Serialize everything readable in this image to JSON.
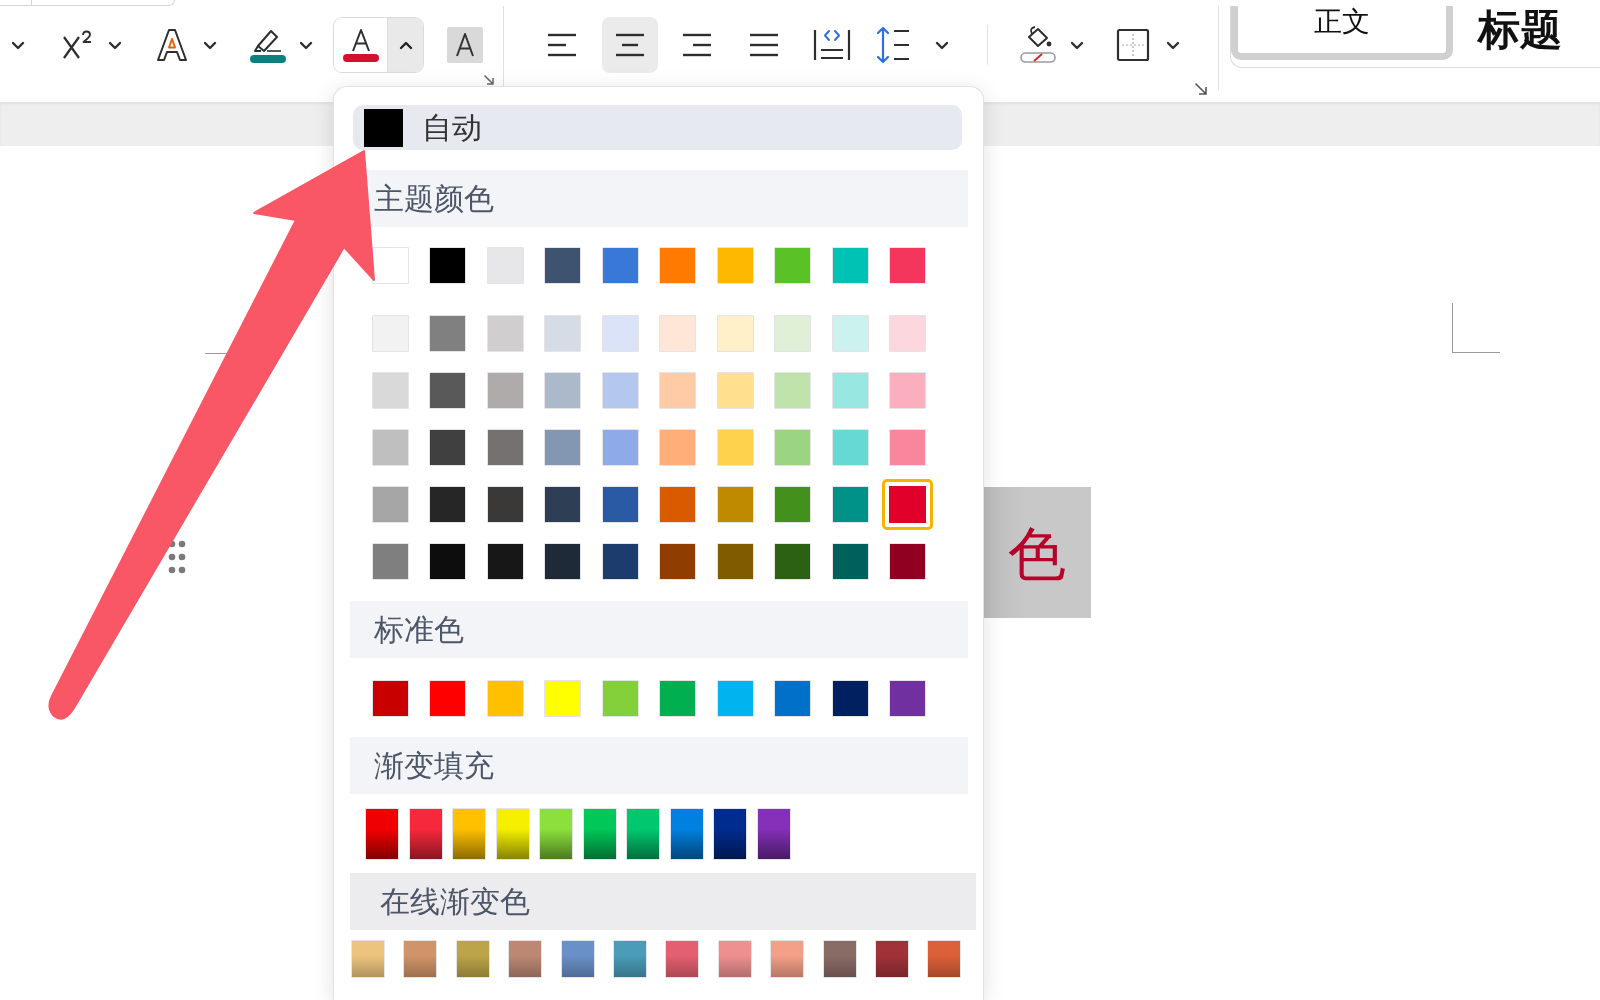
{
  "toolbar": {
    "font_color_button": {
      "expanded": true
    },
    "alignment": [
      {
        "kind": "left",
        "selected": false
      },
      {
        "kind": "center",
        "selected": true
      },
      {
        "kind": "right",
        "selected": false
      },
      {
        "kind": "justify",
        "selected": false
      },
      {
        "kind": "distributed",
        "selected": false
      }
    ],
    "styles": [
      {
        "kind": "body",
        "label": "正文",
        "selected": true
      },
      {
        "kind": "heading",
        "label": "标题",
        "selected": false
      }
    ]
  },
  "document": {
    "highlighted_text": "色"
  },
  "color_menu": {
    "auto": {
      "label": "自动",
      "color": "#000000"
    },
    "sections": [
      {
        "kind": "grid",
        "title": "主题颜色",
        "rows": [
          [
            {
              "color": "#ffffff",
              "selected": false
            },
            {
              "color": "#000000",
              "selected": false
            },
            {
              "color": "#e7e6e8",
              "selected": false
            },
            {
              "color": "#3e5370",
              "selected": false
            },
            {
              "color": "#3a78d8",
              "selected": false
            },
            {
              "color": "#ff7a00",
              "selected": false
            },
            {
              "color": "#ffb800",
              "selected": false
            },
            {
              "color": "#5ac126",
              "selected": false
            },
            {
              "color": "#00c2b4",
              "selected": false
            },
            {
              "color": "#f5365c",
              "selected": false
            }
          ],
          [
            {
              "color": "#f2f2f2",
              "selected": false
            },
            {
              "color": "#808080",
              "selected": false
            },
            {
              "color": "#d0cece",
              "selected": false
            },
            {
              "color": "#d6dce5",
              "selected": false
            },
            {
              "color": "#dae3f8",
              "selected": false
            },
            {
              "color": "#ffe6d6",
              "selected": false
            },
            {
              "color": "#fff0c9",
              "selected": false
            },
            {
              "color": "#dff0d7",
              "selected": false
            },
            {
              "color": "#ccf2ef",
              "selected": false
            },
            {
              "color": "#fdd7de",
              "selected": false
            }
          ],
          [
            {
              "color": "#d9d9d9",
              "selected": false
            },
            {
              "color": "#595959",
              "selected": false
            },
            {
              "color": "#afabab",
              "selected": false
            },
            {
              "color": "#acb9ca",
              "selected": false
            },
            {
              "color": "#b4c7ef",
              "selected": false
            },
            {
              "color": "#ffcaa6",
              "selected": false
            },
            {
              "color": "#ffe08f",
              "selected": false
            },
            {
              "color": "#bfe3aa",
              "selected": false
            },
            {
              "color": "#99e7e1",
              "selected": false
            },
            {
              "color": "#fbaebd",
              "selected": false
            }
          ],
          [
            {
              "color": "#bfbfbf",
              "selected": false
            },
            {
              "color": "#404040",
              "selected": false
            },
            {
              "color": "#767171",
              "selected": false
            },
            {
              "color": "#8497b0",
              "selected": false
            },
            {
              "color": "#8eaae8",
              "selected": false
            },
            {
              "color": "#ffae7a",
              "selected": false
            },
            {
              "color": "#ffd24d",
              "selected": false
            },
            {
              "color": "#9cd581",
              "selected": false
            },
            {
              "color": "#66dad2",
              "selected": false
            },
            {
              "color": "#f9869c",
              "selected": false
            }
          ],
          [
            {
              "color": "#a6a6a6",
              "selected": false
            },
            {
              "color": "#262626",
              "selected": false
            },
            {
              "color": "#3b3838",
              "selected": false
            },
            {
              "color": "#2e3e54",
              "selected": false
            },
            {
              "color": "#2b5aa5",
              "selected": false
            },
            {
              "color": "#d95b00",
              "selected": false
            },
            {
              "color": "#bf8a00",
              "selected": false
            },
            {
              "color": "#43911c",
              "selected": false
            },
            {
              "color": "#009187",
              "selected": false
            },
            {
              "color": "#e0002a",
              "selected": true
            }
          ],
          [
            {
              "color": "#7f7f7f",
              "selected": false
            },
            {
              "color": "#0d0d0d",
              "selected": false
            },
            {
              "color": "#171717",
              "selected": false
            },
            {
              "color": "#1f2a38",
              "selected": false
            },
            {
              "color": "#1d3c6e",
              "selected": false
            },
            {
              "color": "#8f3d00",
              "selected": false
            },
            {
              "color": "#7f5c00",
              "selected": false
            },
            {
              "color": "#2c6113",
              "selected": false
            },
            {
              "color": "#00615a",
              "selected": false
            },
            {
              "color": "#900020",
              "selected": false
            }
          ]
        ]
      },
      {
        "kind": "row",
        "title": "标准色",
        "swatches": [
          {
            "color": "#c80000",
            "selected": false
          },
          {
            "color": "#ff0000",
            "selected": false
          },
          {
            "color": "#ffc000",
            "selected": false
          },
          {
            "color": "#ffff00",
            "selected": false
          },
          {
            "color": "#84d03a",
            "selected": false
          },
          {
            "color": "#00b050",
            "selected": false
          },
          {
            "color": "#00b4f0",
            "selected": false
          },
          {
            "color": "#0070c8",
            "selected": false
          },
          {
            "color": "#002060",
            "selected": false
          },
          {
            "color": "#7030a0",
            "selected": false
          }
        ]
      },
      {
        "kind": "gradient",
        "title": "渐变填充",
        "swatches": [
          {
            "color": "#f00000",
            "selected": false
          },
          {
            "color": "#f8283c",
            "selected": false
          },
          {
            "color": "#ffc000",
            "selected": false
          },
          {
            "color": "#f5f000",
            "selected": false
          },
          {
            "color": "#8ce03c",
            "selected": false
          },
          {
            "color": "#00c858",
            "selected": false
          },
          {
            "color": "#00c86e",
            "selected": false
          },
          {
            "color": "#0080e0",
            "selected": false
          },
          {
            "color": "#002c90",
            "selected": false
          },
          {
            "color": "#8430b8",
            "selected": false
          }
        ]
      },
      {
        "kind": "online",
        "title": "在线渐变色",
        "swatches": [
          {
            "color": "#ecc47e",
            "selected": false
          },
          {
            "color": "#d09468",
            "selected": false
          },
          {
            "color": "#bca448",
            "selected": false
          },
          {
            "color": "#bc8874",
            "selected": false
          },
          {
            "color": "#6a90c8",
            "selected": false
          },
          {
            "color": "#4a9cb8",
            "selected": false
          },
          {
            "color": "#e46070",
            "selected": false
          },
          {
            "color": "#ee9090",
            "selected": false
          },
          {
            "color": "#f4a088",
            "selected": false
          },
          {
            "color": "#8a6c66",
            "selected": false
          },
          {
            "color": "#a03238",
            "selected": false
          },
          {
            "color": "#dc6038",
            "selected": false
          }
        ]
      }
    ]
  }
}
